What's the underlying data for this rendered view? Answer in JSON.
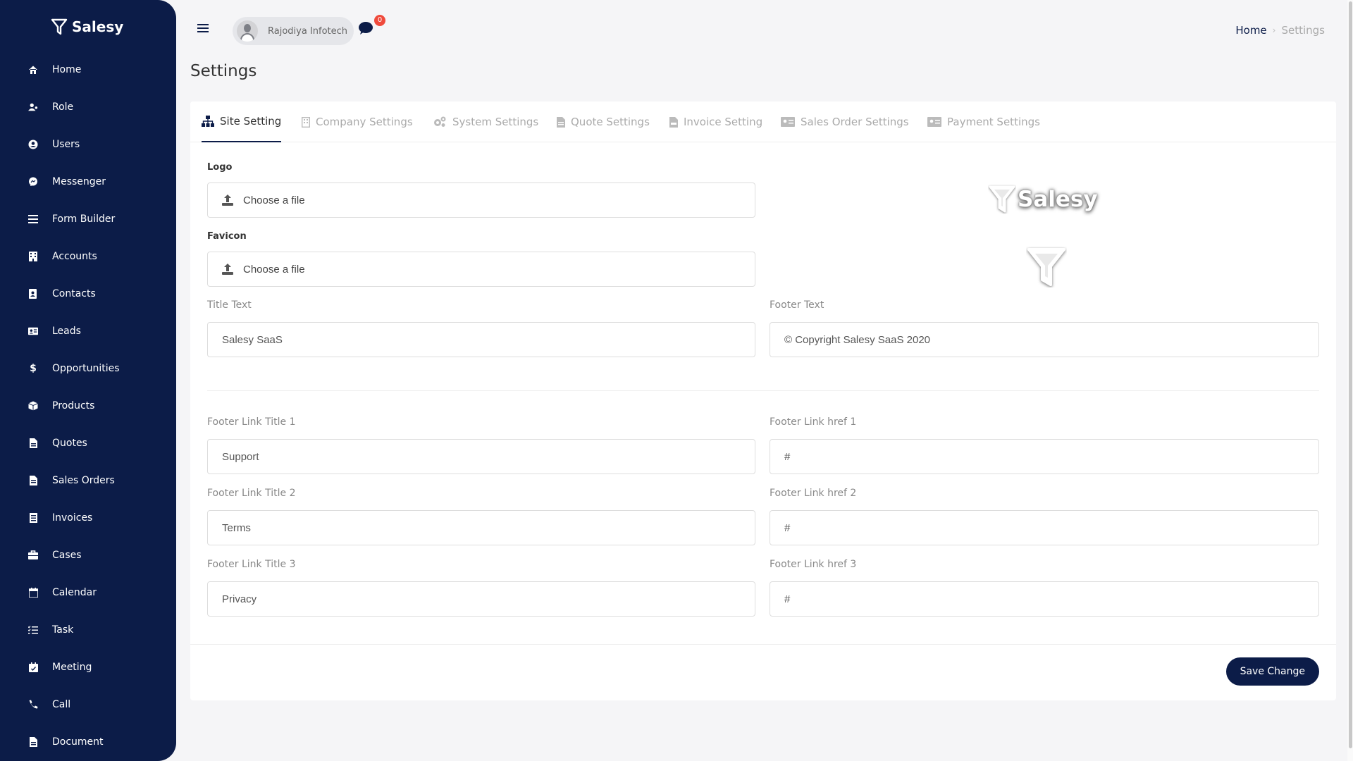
{
  "app": {
    "name": "Salesy"
  },
  "sidebar": {
    "items": [
      {
        "label": "Home",
        "icon": "home-icon"
      },
      {
        "label": "Role",
        "icon": "user-role-icon"
      },
      {
        "label": "Users",
        "icon": "user-circle-icon"
      },
      {
        "label": "Messenger",
        "icon": "messenger-icon"
      },
      {
        "label": "Form Builder",
        "icon": "list-icon"
      },
      {
        "label": "Accounts",
        "icon": "building-icon"
      },
      {
        "label": "Contacts",
        "icon": "address-book-icon"
      },
      {
        "label": "Leads",
        "icon": "id-card-icon"
      },
      {
        "label": "Opportunities",
        "icon": "dollar-icon"
      },
      {
        "label": "Products",
        "icon": "box-icon"
      },
      {
        "label": "Quotes",
        "icon": "file-invoice-icon"
      },
      {
        "label": "Sales Orders",
        "icon": "file-order-icon"
      },
      {
        "label": "Invoices",
        "icon": "receipt-icon"
      },
      {
        "label": "Cases",
        "icon": "briefcase-icon"
      },
      {
        "label": "Calendar",
        "icon": "calendar-icon"
      },
      {
        "label": "Task",
        "icon": "tasks-icon"
      },
      {
        "label": "Meeting",
        "icon": "calendar-check-icon"
      },
      {
        "label": "Call",
        "icon": "phone-icon"
      },
      {
        "label": "Document",
        "icon": "document-icon"
      }
    ]
  },
  "header": {
    "user_name": "Rajodiya Infotech",
    "chat_count": "0",
    "breadcrumb": {
      "home": "Home",
      "separator": "›",
      "current": "Settings"
    }
  },
  "page": {
    "title": "Settings"
  },
  "tabs": [
    {
      "label": "Site Setting",
      "icon": "sitemap-icon",
      "active": true
    },
    {
      "label": "Company Settings",
      "icon": "building-icon",
      "active": false
    },
    {
      "label": "System Settings",
      "icon": "cogs-icon",
      "active": false
    },
    {
      "label": "Quote Settings",
      "icon": "file-icon",
      "active": false
    },
    {
      "label": "Invoice Setting",
      "icon": "file-invoice-icon",
      "active": false
    },
    {
      "label": "Sales Order Settings",
      "icon": "id-card-icon",
      "active": false
    },
    {
      "label": "Payment Settings",
      "icon": "id-card-icon",
      "active": false
    }
  ],
  "form": {
    "logo": {
      "label": "Logo",
      "placeholder": "Choose a file"
    },
    "favicon": {
      "label": "Favicon",
      "placeholder": "Choose a file"
    },
    "title_text": {
      "label": "Title Text",
      "value": "Salesy SaaS"
    },
    "footer_text": {
      "label": "Footer Text",
      "value": "© Copyright Salesy SaaS 2020"
    },
    "footer_links": [
      {
        "title_label": "Footer Link Title 1",
        "title_value": "Support",
        "href_label": "Footer Link href 1",
        "href_value": "#"
      },
      {
        "title_label": "Footer Link Title 2",
        "title_value": "Terms",
        "href_label": "Footer Link href 2",
        "href_value": "#"
      },
      {
        "title_label": "Footer Link Title 3",
        "title_value": "Privacy",
        "href_label": "Footer Link href 3",
        "href_value": "#"
      }
    ],
    "save_label": "Save Change"
  },
  "preview": {
    "logo_text": "Salesy"
  },
  "colors": {
    "sidebar": "#0c1c48",
    "accent": "#0c1c48",
    "badge": "#ef4a3c"
  }
}
